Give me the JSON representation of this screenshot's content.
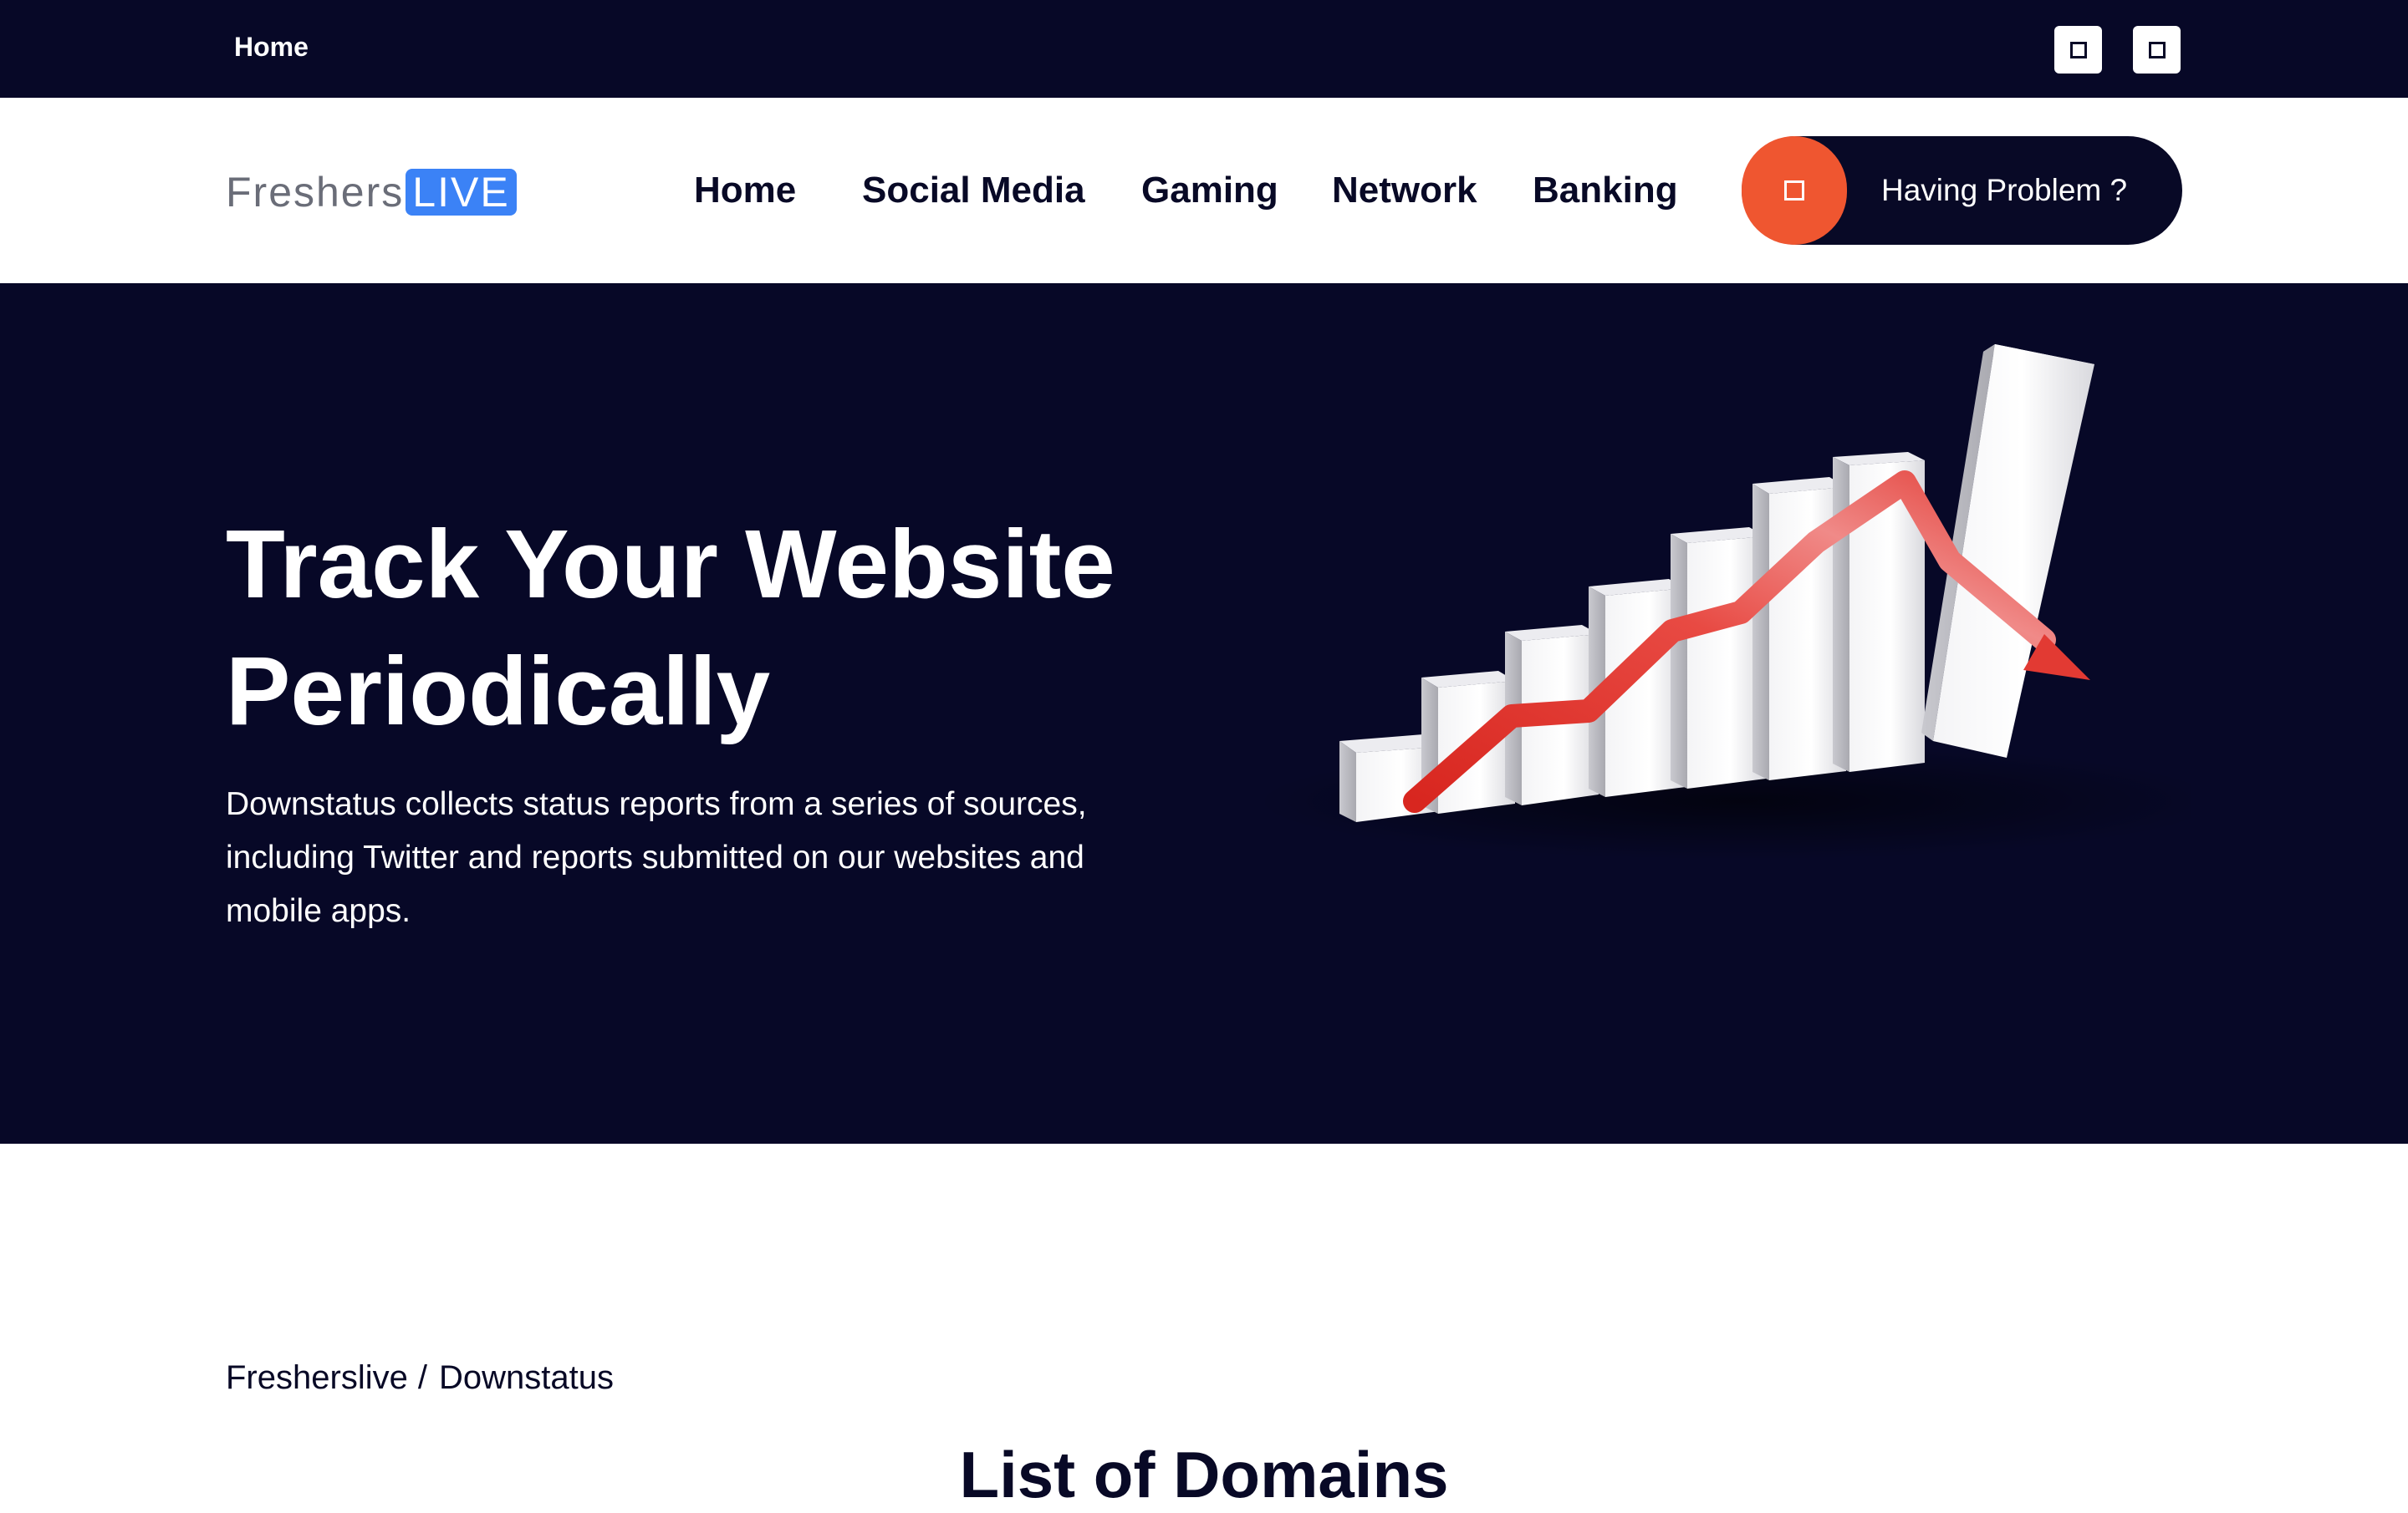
{
  "topbar": {
    "home_label": "Home",
    "icons": [
      "square-icon",
      "square-icon"
    ]
  },
  "header": {
    "logo": {
      "part1": "Freshers",
      "part2": "LIVE"
    },
    "nav": [
      "Home",
      "Social Media",
      "Gaming",
      "Network",
      "Banking"
    ],
    "cta_label": "Having Problem ?",
    "cta_icon": "square-icon"
  },
  "hero": {
    "title_line1": "Track Your Website",
    "title_line2": "Periodically",
    "description": "Downstatus collects status reports from a series of sources, including Twitter and reports submitted on our websites and mobile apps.",
    "illustration": "bar-chart-trend-illustration"
  },
  "breadcrumb": {
    "root": "Fresherslive",
    "separator": "/",
    "current": "Downstatus"
  },
  "section": {
    "title": "List of Domains"
  },
  "colors": {
    "navy": "#070827",
    "accent_orange": "#ef5630",
    "logo_blue": "#3b82f6",
    "trend_red": "#e5322b"
  }
}
